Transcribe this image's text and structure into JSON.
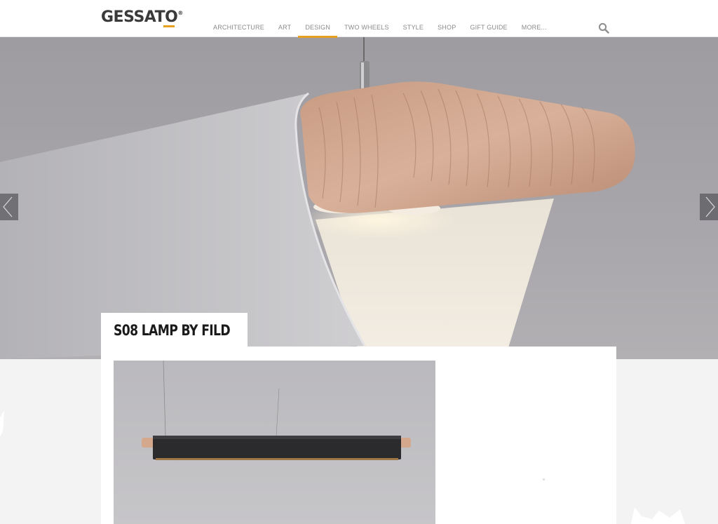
{
  "header": {
    "logo_text": "GESSATO",
    "logo_mark": "®",
    "nav": [
      {
        "label": "ARCHITECTURE",
        "active": false
      },
      {
        "label": "ART",
        "active": false
      },
      {
        "label": "DESIGN",
        "active": true
      },
      {
        "label": "TWO WHEELS",
        "active": false
      },
      {
        "label": "STYLE",
        "active": false
      },
      {
        "label": "SHOP",
        "active": false
      },
      {
        "label": "GIFT GUIDE",
        "active": false
      },
      {
        "label": "MORE...",
        "active": false
      }
    ],
    "search_icon": "search-icon"
  },
  "hero": {
    "prev_icon": "chevron-left-icon",
    "next_icon": "chevron-right-icon"
  },
  "article": {
    "title": "S08 LAMP BY FILD"
  },
  "colors": {
    "accent": "#e8a020",
    "nav_text": "#8a8a8a",
    "title_text": "#1a1a1a",
    "page_bg": "#f3f3f3"
  }
}
